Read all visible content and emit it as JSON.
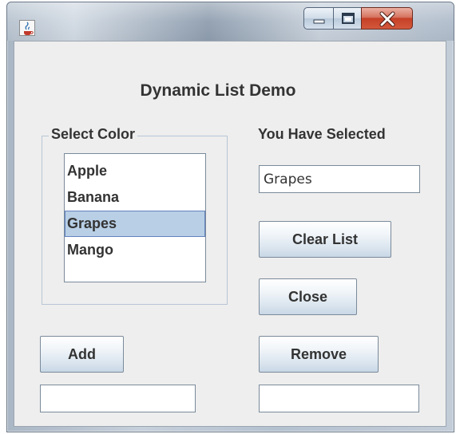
{
  "window": {
    "title": "",
    "controls": {
      "minimize": "minimize",
      "maximize": "maximize",
      "close": "close"
    }
  },
  "heading": "Dynamic List Demo",
  "list_group": {
    "title": "Select Color",
    "items": [
      "Apple",
      "Banana",
      "Grapes",
      "Mango"
    ],
    "selected_index": 2
  },
  "selection": {
    "label": "You Have Selected",
    "value": "Grapes"
  },
  "buttons": {
    "clear_list": "Clear List",
    "close": "Close",
    "add": "Add",
    "remove": "Remove"
  },
  "inputs": {
    "add_value": "",
    "remove_value": ""
  },
  "icons": {
    "app": "java-cup-icon",
    "minimize": "minimize-icon",
    "maximize": "maximize-icon",
    "close": "close-icon"
  },
  "colors": {
    "selection_bg": "#b8cfe5",
    "selection_border": "#6382bf",
    "close_button": "#c54026"
  }
}
